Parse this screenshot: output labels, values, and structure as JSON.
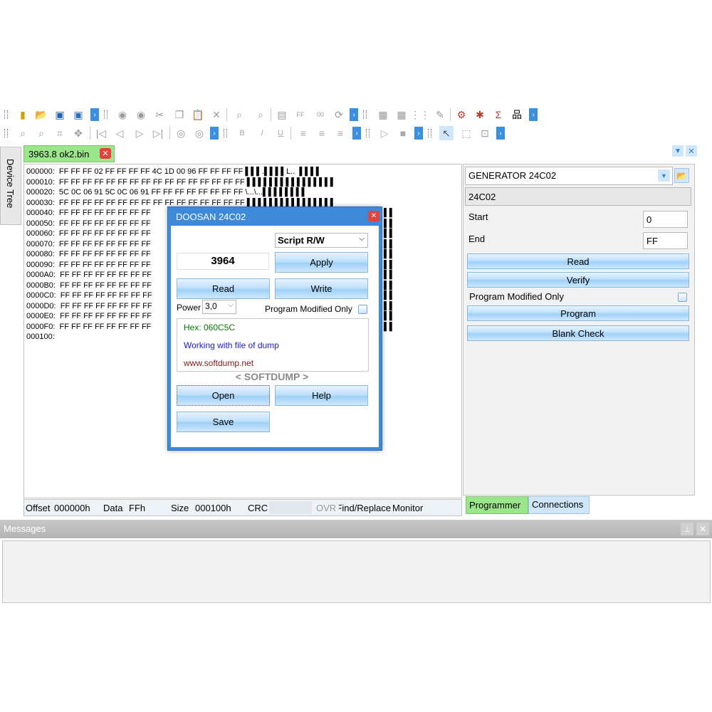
{
  "toolbar1": {
    "icons": [
      "grip",
      "new-chip-icon",
      "open-folder-icon",
      "save-icon",
      "save-as-icon",
      "more",
      "undo-icon",
      "redo-icon",
      "cut-icon",
      "copy-icon",
      "paste-icon",
      "delete-icon",
      "find-icon",
      "replace-icon",
      "document-icon",
      "fill-ff-icon",
      "fill-00-icon",
      "refresh-icon",
      "more",
      "copy-block-icon",
      "paste-block-icon",
      "grid-icon",
      "edit-icon",
      "scripts-icon",
      "bug-icon",
      "sum-icon",
      "network-icon",
      "more"
    ]
  },
  "toolbar2": {
    "icons": [
      "zoom-in-icon",
      "zoom-out-icon",
      "fit-icon",
      "move-icon",
      "first-icon",
      "prev-icon",
      "next-icon",
      "last-icon",
      "back-icon",
      "forward-icon",
      "bold-icon",
      "italic-icon",
      "underline-icon",
      "align-left-icon",
      "align-center-icon",
      "align-right-icon",
      "play-icon",
      "stop-icon",
      "pointer-icon",
      "select-icon",
      "frame-icon"
    ]
  },
  "side_tab": {
    "label": "Device Tree"
  },
  "file_tab": {
    "label": "3963.8 ok2.bin"
  },
  "hex": {
    "lines": [
      "000000:  FF FF FF 02 FF FF FF FF 4C 1D 00 96 FF FF FF FF ▌▌▌.▌▌▌▌L..  ▌▌▌▌",
      "000010:  FF FF FF FF FF FF FF FF FF FF FF FF FF FF FF FF ▌▌▌▌▌▌▌▌▌▌▌▌▌▌▌▌",
      "000020:  5C 0C 06 91 5C 0C 06 91 FF FF FF FF FF FF FF FF \\...\\...▌▌▌▌▌▌▌▌",
      "000030:  FF FF FF FF FF FF FF FF FF FF FF FF FF FF FF FF ▌▌▌▌▌▌▌▌▌▌▌▌▌▌▌▌",
      "000040:  FF FF FF FF FF FF FF FF",
      "000050:  FF FF FF FF FF FF FF FF",
      "000060:  FF FF FF FF FF FF FF FF",
      "000070:  FF FF FF FF FF FF FF FF",
      "000080:  FF FF FF FF FF FF FF FF",
      "000090:  FF FF FF FF FF FF FF FF",
      "0000A0:  FF FF FF FF FF FF FF FF",
      "0000B0:  FF FF FF FF FF FF FF FF",
      "0000C0:  FF FF FF FF FF FF FF FF",
      "0000D0:  FF FF FF FF FF FF FF FF",
      "0000E0:  FF FF FF FF FF FF FF FF",
      "0000F0:  FF FF FF FF FF FF FF FF",
      "000100:"
    ],
    "right_ascii": [
      "▌▌",
      "▌▌",
      "▌▌",
      "▌▌",
      "▌▌",
      "▌▌",
      "▌▌",
      "▌▌",
      "▌▌",
      "▌▌",
      "▌▌",
      "▌▌"
    ]
  },
  "status": {
    "offset_label": "Offset",
    "offset_value": "000000h",
    "data_label": "Data",
    "data_value": "FFh",
    "size_label": "Size",
    "size_value": "000100h",
    "crc_label": "CRC",
    "crc_value": "",
    "ovr": "OVR",
    "find_replace": "Find/Replace",
    "monitor": "Monitor"
  },
  "programmer": {
    "device_select": "GENERATOR 24C02",
    "device_name": "24C02",
    "start_label": "Start",
    "start_value": "0",
    "end_label": "End",
    "end_value": "FF",
    "read": "Read",
    "verify": "Verify",
    "modified_only": "Program Modified Only",
    "program": "Program",
    "blank_check": "Blank Check",
    "tabs": [
      "Programmer",
      "Connections"
    ]
  },
  "dialog": {
    "title": "DOOSAN 24C02",
    "script_select": "Script R/W",
    "value": "3964",
    "apply": "Apply",
    "read": "Read",
    "write": "Write",
    "power_label": "Power",
    "power_value": "3,0",
    "modified_only": "Program Modified Only",
    "hex_line": "Hex: 060C5C",
    "working_line": "Working with file of dump",
    "url_line": "www.softdump.net",
    "brand": "< SOFTDUMP >",
    "open": "Open",
    "help": "Help",
    "save": "Save"
  },
  "messages": {
    "title": "Messages"
  },
  "colors": {
    "accent": "#3b8fe0",
    "tab_green": "#9be58a",
    "dialog_border": "#2f7fd2",
    "hex_green": "#008000",
    "link_blue": "#1a1acc",
    "url_maroon": "#7a1a1a"
  }
}
